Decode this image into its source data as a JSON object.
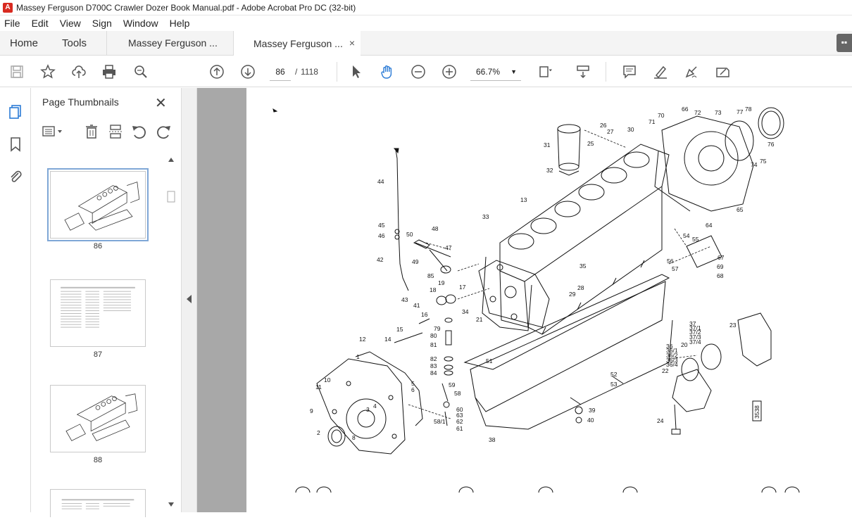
{
  "window": {
    "title": "Massey Ferguson D700C Crawler Dozer Book Manual.pdf - Adobe Acrobat Pro DC (32-bit)",
    "app_icon": "acrobat-icon",
    "accent": "#d82a20"
  },
  "menu": [
    "File",
    "Edit",
    "View",
    "Sign",
    "Window",
    "Help"
  ],
  "tabs": {
    "home": "Home",
    "tools": "Tools",
    "doc1": "Massey Ferguson ...",
    "doc2": "Massey Ferguson ...",
    "doc2_close": "×"
  },
  "toolbar": {
    "icons": [
      "save-icon",
      "bookmark-star-icon",
      "upload-icon",
      "print-icon",
      "find-icon",
      "page-up-icon",
      "page-down-icon",
      "select-cursor-icon",
      "hand-icon",
      "zoom-out-icon",
      "zoom-in-icon",
      "page-fit-icon",
      "scroll-mode-icon",
      "comment-icon",
      "highlight-icon",
      "sign-icon",
      "fill-sign-icon"
    ],
    "page_current": "86",
    "page_separator": "/",
    "page_total": "1118",
    "zoom": "66.7%"
  },
  "thumbnails_panel": {
    "title": "Page Thumbnails",
    "close": "✕",
    "pages": [
      {
        "label": "86",
        "selected": true
      },
      {
        "label": "87",
        "selected": false
      },
      {
        "label": "88",
        "selected": false
      }
    ]
  },
  "diagram": {
    "part_numbers": [
      "1",
      "2",
      "3",
      "4",
      "5",
      "6",
      "8",
      "9",
      "10",
      "11",
      "12",
      "13",
      "14",
      "15",
      "16",
      "17",
      "18",
      "19",
      "20",
      "21",
      "22",
      "23",
      "24",
      "25",
      "26",
      "27",
      "28",
      "29",
      "30",
      "31",
      "32",
      "33",
      "34",
      "35",
      "36",
      "37",
      "38",
      "39",
      "40",
      "41",
      "42",
      "43",
      "44",
      "45",
      "46",
      "47",
      "48",
      "49",
      "50",
      "51",
      "52",
      "53",
      "54",
      "55",
      "56",
      "57",
      "58",
      "59",
      "60",
      "61",
      "62",
      "63",
      "64",
      "65",
      "66",
      "67",
      "68",
      "69",
      "70",
      "71",
      "72",
      "73",
      "74",
      "75",
      "76",
      "77",
      "78",
      "79",
      "80",
      "81",
      "82",
      "83",
      "84",
      "85",
      "36/1",
      "36/2",
      "36/3",
      "36/4",
      "37/1",
      "37/2",
      "37/3",
      "37/4",
      "58/1"
    ],
    "reference": "3538"
  }
}
